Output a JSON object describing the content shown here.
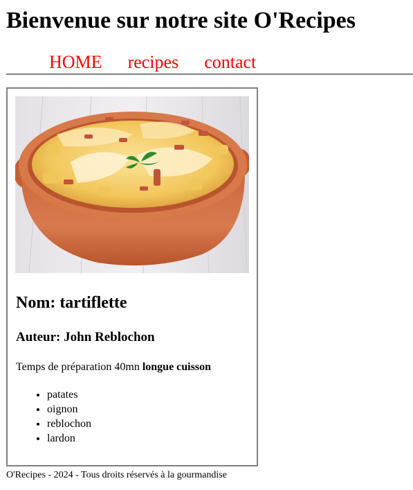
{
  "header": {
    "title": "Bienvenue sur notre site O'Recipes"
  },
  "nav": {
    "items": [
      {
        "label": "HOME"
      },
      {
        "label": "recipes"
      },
      {
        "label": "contact"
      }
    ],
    "link_color": "#ff0000"
  },
  "recipe": {
    "name": "Nom: tartiflette",
    "author": "Auteur: John Reblochon",
    "time_text": "Temps de préparation 40mn",
    "difficulty": "longue cuisson",
    "ingredients": [
      "patates",
      "oignon",
      "reblochon",
      "lardon"
    ]
  },
  "footer": {
    "text": "O'Recipes - 2024 - Tous droits réservés à la gourmandise"
  }
}
